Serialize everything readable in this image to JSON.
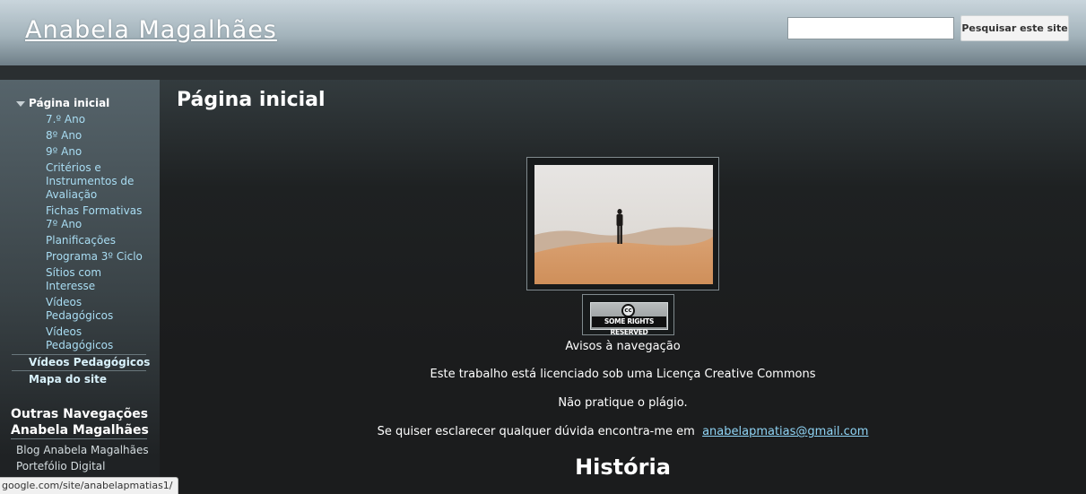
{
  "header": {
    "site_title": "Anabela Magalhães",
    "search_placeholder": "",
    "search_button": "Pesquisar este site"
  },
  "sidebar": {
    "home": "Página inicial",
    "items": [
      "7.º Ano",
      "8º Ano",
      "9º Ano",
      "Critérios e Instrumentos de Avaliação",
      "Fichas Formativas 7º Ano",
      "Planificações",
      "Programa 3º Ciclo",
      "Sítios com Interesse",
      "Vídeos Pedagógicos",
      "Vídeos Pedagógicos"
    ],
    "top_items": [
      "Vídeos Pedagógicos",
      "Mapa do site"
    ],
    "other_title": "Outras Navegações Anabela Magalhães",
    "other_links": [
      "Blog Anabela Magalhães",
      "Portefólio Digital"
    ]
  },
  "main": {
    "heading": "Página inicial",
    "cc_badge_label": "SOME RIGHTS RESERVED",
    "cc_symbol": "cc",
    "notice_title": "Avisos à navegação",
    "license_text": "Este trabalho está licenciado sob uma Licença Creative Commons",
    "plagiarism_text": "Não pratique o plágio.",
    "contact_text": "Se quiser esclarecer qualquer dúvida encontra-me em",
    "email": "anabelapmatias@gmail.com",
    "section_heading": "História"
  },
  "status_bar": {
    "url": "google.com/site/anabelapmatias1/"
  },
  "colors": {
    "link": "#a9ddf3",
    "header_gradient_top": "#c9d5dc",
    "background": "#1d1d1d"
  }
}
